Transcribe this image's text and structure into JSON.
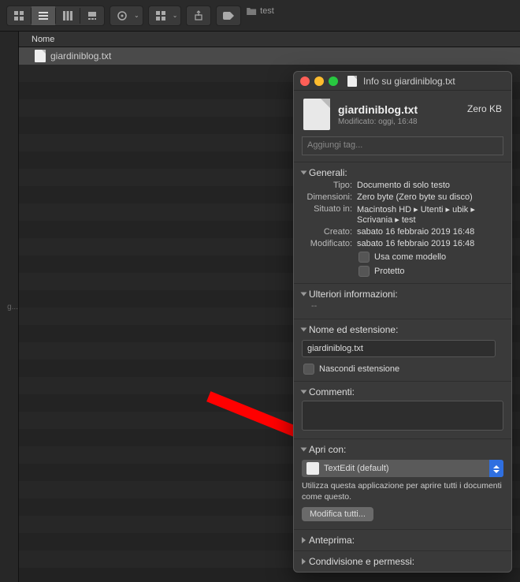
{
  "path_crumb": "test",
  "toolbar": {
    "views": [
      "icon",
      "list",
      "column",
      "gallery"
    ]
  },
  "list": {
    "header": "Nome",
    "file": "giardiniblog.txt"
  },
  "sidebar_label": "g...",
  "info": {
    "window_title": "Info su giardiniblog.txt",
    "file_name": "giardiniblog.txt",
    "file_size": "Zero KB",
    "modified_summary": "Modificato: oggi, 16:48",
    "tags_placeholder": "Aggiungi tag...",
    "sections": {
      "general": {
        "title": "Generali:",
        "tipo_label": "Tipo",
        "tipo": "Documento di solo testo",
        "dim_label": "Dimensioni",
        "dim": "Zero byte (Zero byte su disco)",
        "loc_label": "Situato in",
        "loc": "Macintosh HD ▸ Utenti ▸ ubik ▸ Scrivania ▸ test",
        "created_label": "Creato",
        "created": "sabato 16 febbraio 2019 16:48",
        "mod_label": "Modificato",
        "mod": "sabato 16 febbraio 2019 16:48",
        "template_label": "Usa come modello",
        "protected_label": "Protetto"
      },
      "more": {
        "title": "Ulteriori informazioni:",
        "value": "--"
      },
      "name_ext": {
        "title": "Nome ed estensione:",
        "value": "giardiniblog.txt",
        "hide_ext": "Nascondi estensione"
      },
      "comments": {
        "title": "Commenti:"
      },
      "open_with": {
        "title": "Apri con:",
        "app": "TextEdit (default)",
        "desc": "Utilizza questa applicazione per aprire tutti i documenti come questo.",
        "button": "Modifica tutti..."
      },
      "preview": {
        "title": "Anteprima:"
      },
      "sharing": {
        "title": "Condivisione e permessi:"
      }
    }
  }
}
